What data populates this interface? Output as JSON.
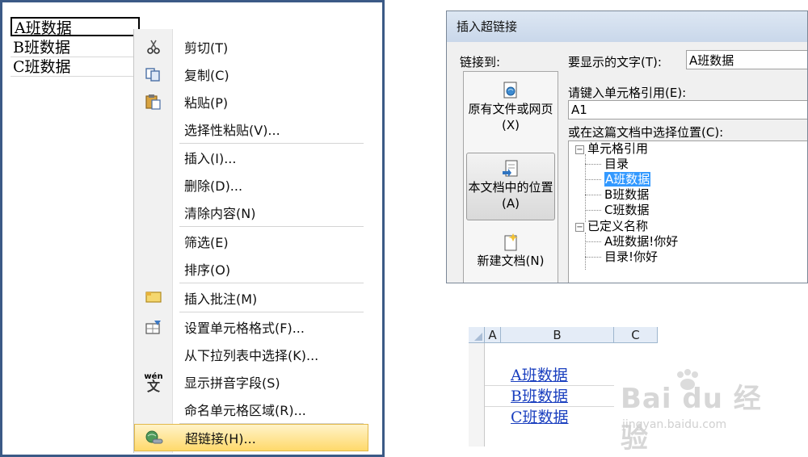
{
  "excel_cells": [
    "A班数据",
    "B班数据",
    "C班数据"
  ],
  "context_menu": {
    "items": [
      {
        "label": "剪切(T)",
        "icon": "scissors-icon"
      },
      {
        "label": "复制(C)",
        "icon": "copy-icon"
      },
      {
        "label": "粘贴(P)",
        "icon": "paste-icon"
      },
      {
        "label": "选择性粘贴(V)...",
        "icon": ""
      },
      {
        "label": "插入(I)...",
        "icon": ""
      },
      {
        "label": "删除(D)...",
        "icon": ""
      },
      {
        "label": "清除内容(N)",
        "icon": ""
      },
      {
        "label": "筛选(E)",
        "icon": ""
      },
      {
        "label": "排序(O)",
        "icon": ""
      },
      {
        "label": "插入批注(M)",
        "icon": "comment-icon"
      },
      {
        "label": "设置单元格格式(F)...",
        "icon": "format-cells-icon"
      },
      {
        "label": "从下拉列表中选择(K)...",
        "icon": ""
      },
      {
        "label": "显示拼音字段(S)",
        "icon": "phonetic-icon"
      },
      {
        "label": "命名单元格区域(R)...",
        "icon": ""
      },
      {
        "label": "超链接(H)...",
        "icon": "hyperlink-icon",
        "highlighted": true
      }
    ],
    "phonetic_icon_text": "wén",
    "phonetic_icon_char": "文"
  },
  "hyperlink_dialog": {
    "title": "插入超链接",
    "link_to_label": "链接到:",
    "link_targets": [
      {
        "label": "原有文件或网页(X)",
        "icon": "web-page-icon"
      },
      {
        "label": "本文档中的位置(A)",
        "icon": "document-place-icon",
        "selected": true
      },
      {
        "label": "新建文档(N)",
        "icon": "new-document-icon"
      }
    ],
    "display_text_label": "要显示的文字(T):",
    "display_text_value": "A班数据",
    "cell_ref_label": "请键入单元格引用(E):",
    "cell_ref_value": "A1",
    "place_label": "或在这篇文档中选择位置(C):",
    "tree": {
      "group1": "单元格引用",
      "group1_items": [
        "目录",
        "A班数据",
        "B班数据",
        "C班数据"
      ],
      "group1_selected": "A班数据",
      "group2": "已定义名称",
      "group2_items": [
        "A班数据!你好",
        "目录!你好"
      ]
    }
  },
  "result_sheet": {
    "columns": [
      "A",
      "B",
      "C"
    ],
    "links": [
      "A班数据",
      "B班数据",
      "C班数据"
    ]
  },
  "watermark": {
    "brand": "Bai du 经验",
    "site": "jingyan.baidu.com"
  },
  "colors": {
    "frame_border": "#3b5a86",
    "menu_highlight": "#ffd96b",
    "tree_selection": "#3399ff",
    "hyperlink": "#1a3fbf"
  }
}
